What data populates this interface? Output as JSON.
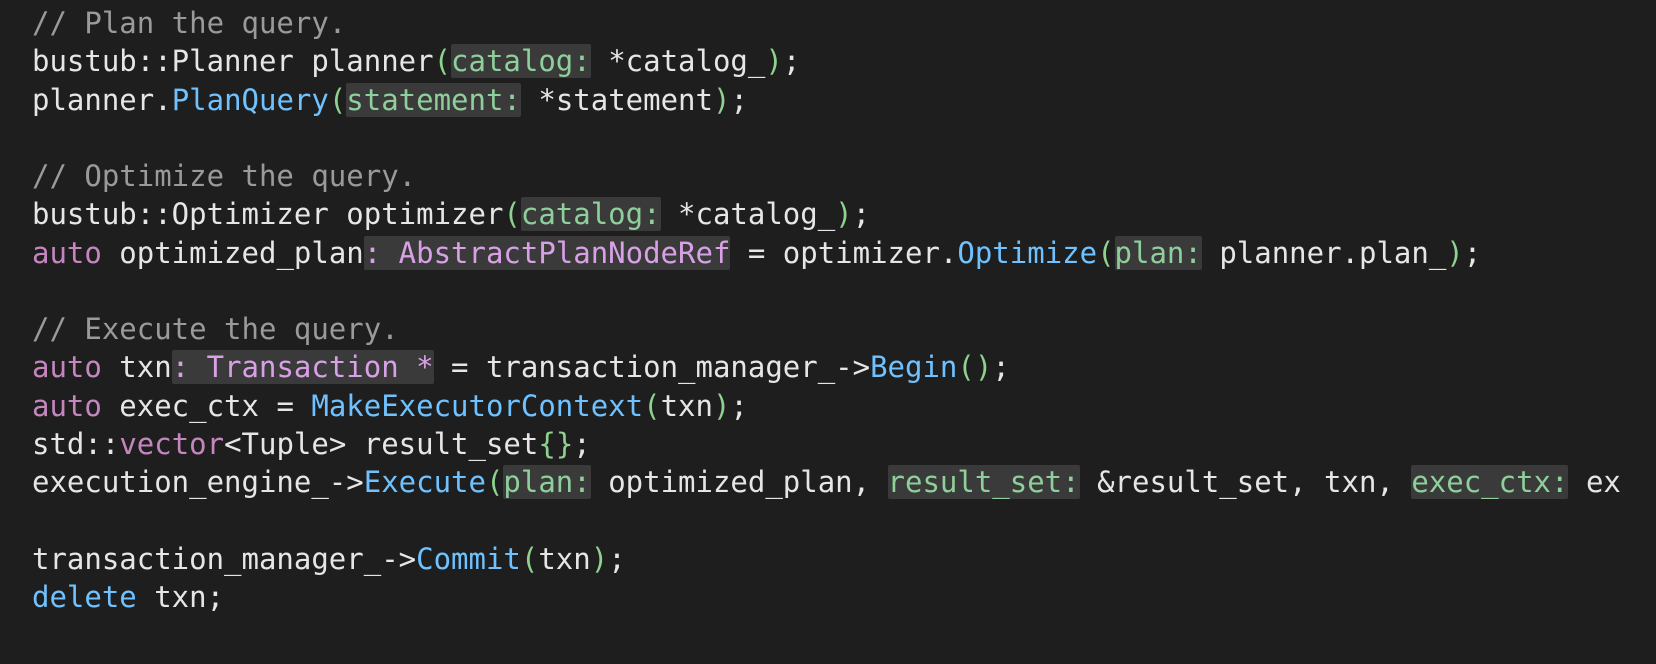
{
  "lines": [
    {
      "tokens": [
        {
          "text": "// Plan the query.",
          "cls": "c-comment"
        }
      ]
    },
    {
      "tokens": [
        {
          "text": "bustub::Planner planner",
          "cls": "c-plain"
        },
        {
          "text": "(",
          "cls": "c-paren"
        },
        {
          "text": "catalog:",
          "cls": "hint"
        },
        {
          "text": " *catalog_",
          "cls": "c-plain"
        },
        {
          "text": ")",
          "cls": "c-paren"
        },
        {
          "text": ";",
          "cls": "c-plain"
        }
      ]
    },
    {
      "tokens": [
        {
          "text": "planner.",
          "cls": "c-plain"
        },
        {
          "text": "PlanQuery",
          "cls": "c-func"
        },
        {
          "text": "(",
          "cls": "c-paren"
        },
        {
          "text": "statement:",
          "cls": "hint"
        },
        {
          "text": " *statement",
          "cls": "c-plain"
        },
        {
          "text": ")",
          "cls": "c-paren"
        },
        {
          "text": ";",
          "cls": "c-plain"
        }
      ]
    },
    {
      "tokens": []
    },
    {
      "tokens": [
        {
          "text": "// Optimize the query.",
          "cls": "c-comment"
        }
      ]
    },
    {
      "tokens": [
        {
          "text": "bustub::Optimizer optimizer",
          "cls": "c-plain"
        },
        {
          "text": "(",
          "cls": "c-paren"
        },
        {
          "text": "catalog:",
          "cls": "hint"
        },
        {
          "text": " *catalog_",
          "cls": "c-plain"
        },
        {
          "text": ")",
          "cls": "c-paren"
        },
        {
          "text": ";",
          "cls": "c-plain"
        }
      ]
    },
    {
      "tokens": [
        {
          "text": "auto",
          "cls": "c-keyword"
        },
        {
          "text": " optimized_plan",
          "cls": "c-plain"
        },
        {
          "text": ": AbstractPlanNodeRef",
          "cls": "hint-type"
        },
        {
          "text": " = optimizer.",
          "cls": "c-plain"
        },
        {
          "text": "Optimize",
          "cls": "c-func"
        },
        {
          "text": "(",
          "cls": "c-paren"
        },
        {
          "text": "plan:",
          "cls": "hint"
        },
        {
          "text": " planner.plan_",
          "cls": "c-plain"
        },
        {
          "text": ")",
          "cls": "c-paren"
        },
        {
          "text": ";",
          "cls": "c-plain"
        }
      ]
    },
    {
      "tokens": []
    },
    {
      "tokens": [
        {
          "text": "// Execute the query.",
          "cls": "c-comment"
        }
      ]
    },
    {
      "tokens": [
        {
          "text": "auto",
          "cls": "c-keyword"
        },
        {
          "text": " txn",
          "cls": "c-plain"
        },
        {
          "text": ": Transaction *",
          "cls": "hint-type"
        },
        {
          "text": " = transaction_manager_->",
          "cls": "c-plain"
        },
        {
          "text": "Begin",
          "cls": "c-func"
        },
        {
          "text": "()",
          "cls": "c-paren"
        },
        {
          "text": ";",
          "cls": "c-plain"
        }
      ]
    },
    {
      "tokens": [
        {
          "text": "auto",
          "cls": "c-keyword"
        },
        {
          "text": " exec_ctx = ",
          "cls": "c-plain"
        },
        {
          "text": "MakeExecutorContext",
          "cls": "c-func"
        },
        {
          "text": "(",
          "cls": "c-paren"
        },
        {
          "text": "txn",
          "cls": "c-plain"
        },
        {
          "text": ")",
          "cls": "c-paren"
        },
        {
          "text": ";",
          "cls": "c-plain"
        }
      ]
    },
    {
      "tokens": [
        {
          "text": "std::",
          "cls": "c-plain"
        },
        {
          "text": "vector",
          "cls": "c-keyword"
        },
        {
          "text": "<Tuple> result_set",
          "cls": "c-plain"
        },
        {
          "text": "{}",
          "cls": "c-paren"
        },
        {
          "text": ";",
          "cls": "c-plain"
        }
      ]
    },
    {
      "tokens": [
        {
          "text": "execution_engine_->",
          "cls": "c-plain"
        },
        {
          "text": "Execute",
          "cls": "c-func"
        },
        {
          "text": "(",
          "cls": "c-paren"
        },
        {
          "text": "plan:",
          "cls": "hint"
        },
        {
          "text": " optimized_plan, ",
          "cls": "c-plain"
        },
        {
          "text": "result_set:",
          "cls": "hint"
        },
        {
          "text": " &result_set, txn, ",
          "cls": "c-plain"
        },
        {
          "text": "exec_ctx:",
          "cls": "hint"
        },
        {
          "text": " ex",
          "cls": "c-plain"
        }
      ]
    },
    {
      "tokens": []
    },
    {
      "tokens": [
        {
          "text": "transaction_manager_->",
          "cls": "c-plain"
        },
        {
          "text": "Commit",
          "cls": "c-func"
        },
        {
          "text": "(",
          "cls": "c-paren"
        },
        {
          "text": "txn",
          "cls": "c-plain"
        },
        {
          "text": ")",
          "cls": "c-paren"
        },
        {
          "text": ";",
          "cls": "c-plain"
        }
      ]
    },
    {
      "tokens": [
        {
          "text": "delete",
          "cls": "c-storage"
        },
        {
          "text": " txn;",
          "cls": "c-plain"
        }
      ]
    }
  ]
}
